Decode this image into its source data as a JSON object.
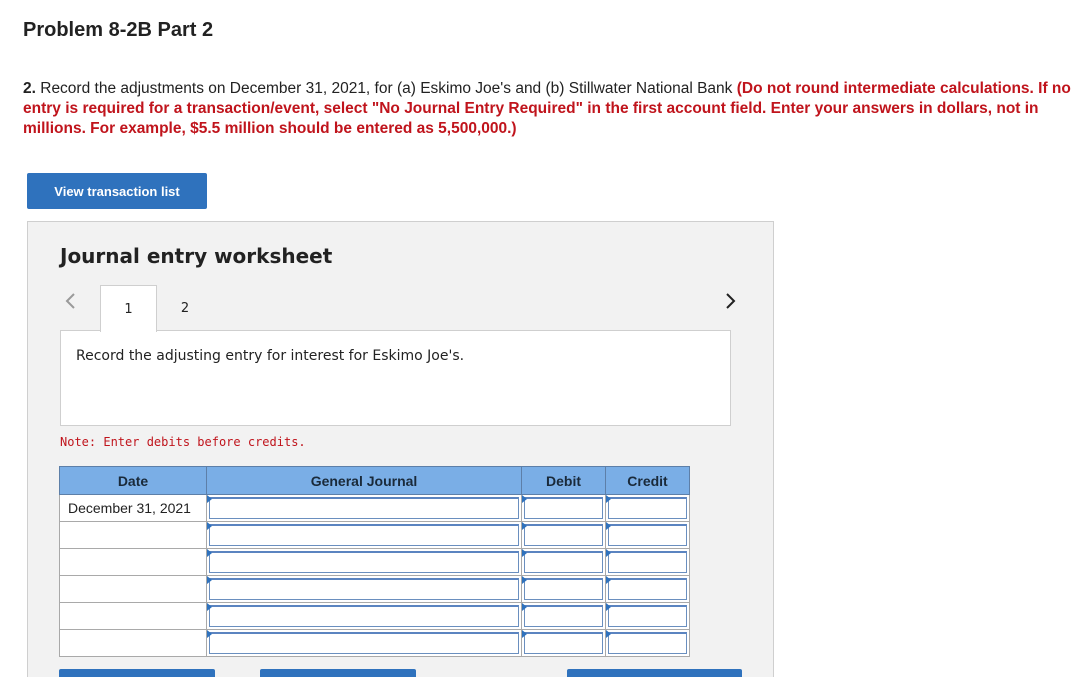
{
  "page": {
    "title": "Problem 8-2B Part 2",
    "instructions": {
      "number": "2.",
      "text": " Record the adjustments on December 31, 2021, for (a) Eskimo Joe's and (b) Stillwater National Bank ",
      "emphasis": "(Do not round intermediate calculations. If no entry is required for a transaction/event, select \"No Journal Entry Required\" in the first account field. Enter your answers in dollars, not in millions. For example, $5.5 million should be entered as 5,500,000.)"
    },
    "view_transaction_label": "View transaction list"
  },
  "worksheet": {
    "title": "Journal entry worksheet",
    "tabs": [
      {
        "label": "1",
        "active": true
      },
      {
        "label": "2",
        "active": false
      }
    ],
    "prompt": "Record the adjusting entry for interest for Eskimo Joe's.",
    "note": "Note: Enter debits before credits.",
    "columns": [
      "Date",
      "General Journal",
      "Debit",
      "Credit"
    ],
    "rows": [
      {
        "date": "December 31, 2021",
        "account": "",
        "debit": "",
        "credit": ""
      },
      {
        "date": "",
        "account": "",
        "debit": "",
        "credit": ""
      },
      {
        "date": "",
        "account": "",
        "debit": "",
        "credit": ""
      },
      {
        "date": "",
        "account": "",
        "debit": "",
        "credit": ""
      },
      {
        "date": "",
        "account": "",
        "debit": "",
        "credit": ""
      },
      {
        "date": "",
        "account": "",
        "debit": "",
        "credit": ""
      }
    ]
  },
  "colors": {
    "accent": "#2f72bd",
    "header_bg": "#7aaee6",
    "emphasis": "#c0141c"
  }
}
